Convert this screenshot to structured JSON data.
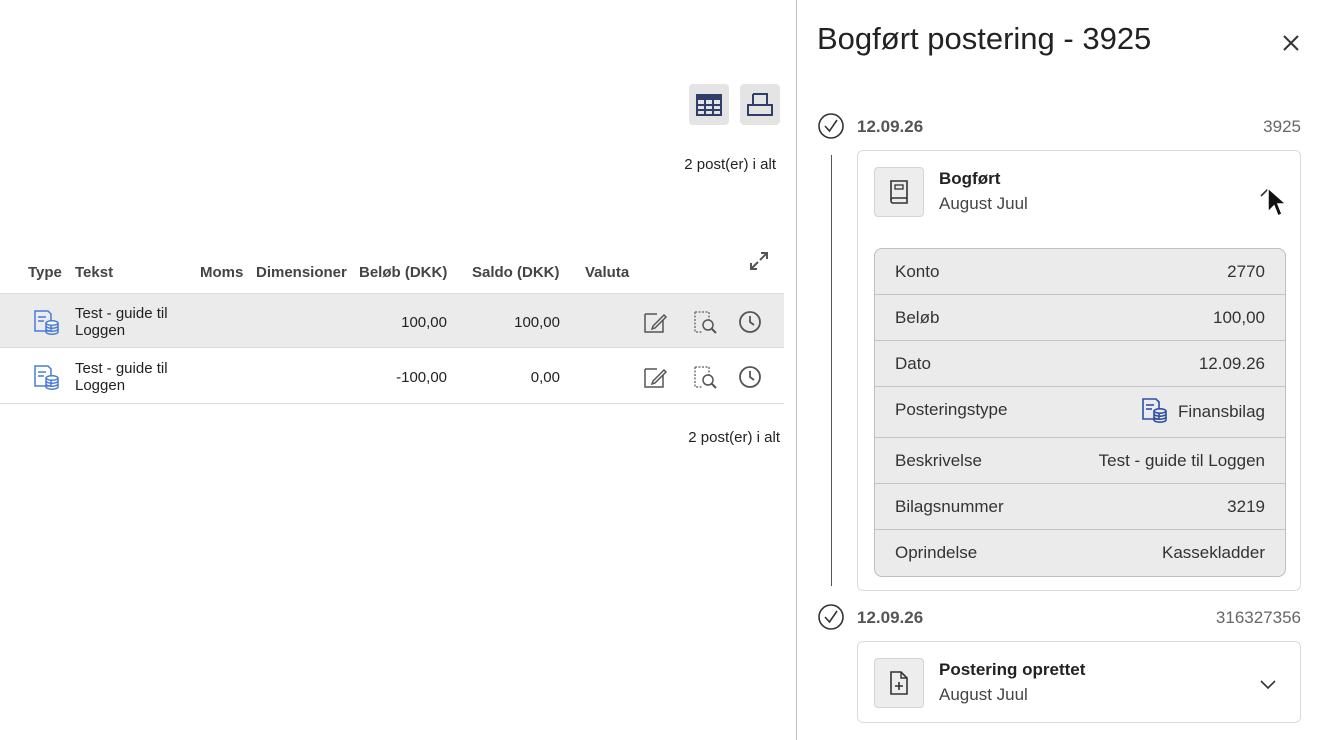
{
  "toolbar": {
    "grid_icon": "table-grid-icon",
    "print_icon": "print-icon"
  },
  "summary": {
    "count_top": "2 post(er) i alt",
    "count_bottom": "2 post(er) i alt"
  },
  "table": {
    "columns": [
      "Type",
      "Tekst",
      "Moms",
      "Dimensioner",
      "Beløb (DKK)",
      "Saldo (DKK)",
      "Valuta"
    ],
    "rows": [
      {
        "type_icon": "finansbilag-icon",
        "text": "Test - guide til Loggen",
        "moms": "",
        "dimensioner": "",
        "belob": "100,00",
        "saldo": "100,00",
        "valuta": ""
      },
      {
        "type_icon": "finansbilag-icon",
        "text": "Test - guide til Loggen",
        "moms": "",
        "dimensioner": "",
        "belob": "-100,00",
        "saldo": "0,00",
        "valuta": ""
      }
    ]
  },
  "panel": {
    "title": "Bogført postering - 3925",
    "events": [
      {
        "date": "12.09.26",
        "number": "3925",
        "title": "Bogført",
        "user": "August Juul",
        "expanded": true,
        "details": [
          {
            "key": "Konto",
            "value": "2770"
          },
          {
            "key": "Beløb",
            "value": "100,00"
          },
          {
            "key": "Dato",
            "value": "12.09.26"
          },
          {
            "key": "Posteringstype",
            "value": "Finansbilag",
            "icon": "finansbilag-icon"
          },
          {
            "key": "Beskrivelse",
            "value": "Test - guide til Loggen"
          },
          {
            "key": "Bilagsnummer",
            "value": "3219"
          },
          {
            "key": "Oprindelse",
            "value": "Kassekladder"
          }
        ]
      },
      {
        "date": "12.09.26",
        "number": "316327356",
        "title": "Postering oprettet",
        "user": "August Juul",
        "expanded": false
      }
    ]
  },
  "colors": {
    "accent_blue": "#4a7bd6",
    "row_highlight": "#ebebeb",
    "button_bg": "#e4e4e4"
  }
}
